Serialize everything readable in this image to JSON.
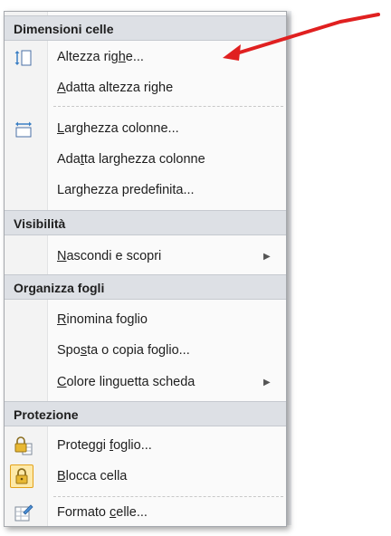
{
  "menu": {
    "sections": [
      {
        "title": "Dimensioni celle",
        "items": [
          {
            "label_pre": "Altezza rig",
            "label_u": "h",
            "label_post": "e...",
            "icon": "row-height-icon"
          },
          {
            "label_pre": "",
            "label_u": "A",
            "label_post": "datta altezza righe",
            "icon": ""
          },
          {
            "label_pre": "",
            "label_u": "L",
            "label_post": "arghezza colonne...",
            "icon": "column-width-icon"
          },
          {
            "label_pre": "Ada",
            "label_u": "t",
            "label_post": "ta larghezza colonne",
            "icon": ""
          },
          {
            "label_pre": "Lar",
            "label_u": "g",
            "label_post": "hezza predefinita...",
            "icon": ""
          }
        ]
      },
      {
        "title": "Visibilità",
        "items": [
          {
            "label_pre": "",
            "label_u": "N",
            "label_post": "ascondi e scopri",
            "icon": "",
            "submenu": true
          }
        ]
      },
      {
        "title": "Organizza fogli",
        "items": [
          {
            "label_pre": "",
            "label_u": "R",
            "label_post": "inomina foglio",
            "icon": ""
          },
          {
            "label_pre": "Spo",
            "label_u": "s",
            "label_post": "ta o copia foglio...",
            "icon": ""
          },
          {
            "label_pre": "",
            "label_u": "C",
            "label_post": "olore linguetta scheda",
            "icon": "",
            "submenu": true
          }
        ]
      },
      {
        "title": "Protezione",
        "items": [
          {
            "label_pre": "Proteggi ",
            "label_u": "f",
            "label_post": "oglio...",
            "icon": "protect-sheet-icon"
          },
          {
            "label_pre": "",
            "label_u": "B",
            "label_post": "locca cella",
            "icon": "lock-cell-icon"
          },
          {
            "label_pre": "Formato ",
            "label_u": "c",
            "label_post": "elle...",
            "icon": "format-cells-icon"
          }
        ]
      }
    ]
  },
  "colors": {
    "annotation_arrow": "#e02020",
    "section_bg": "#dde0e5"
  }
}
